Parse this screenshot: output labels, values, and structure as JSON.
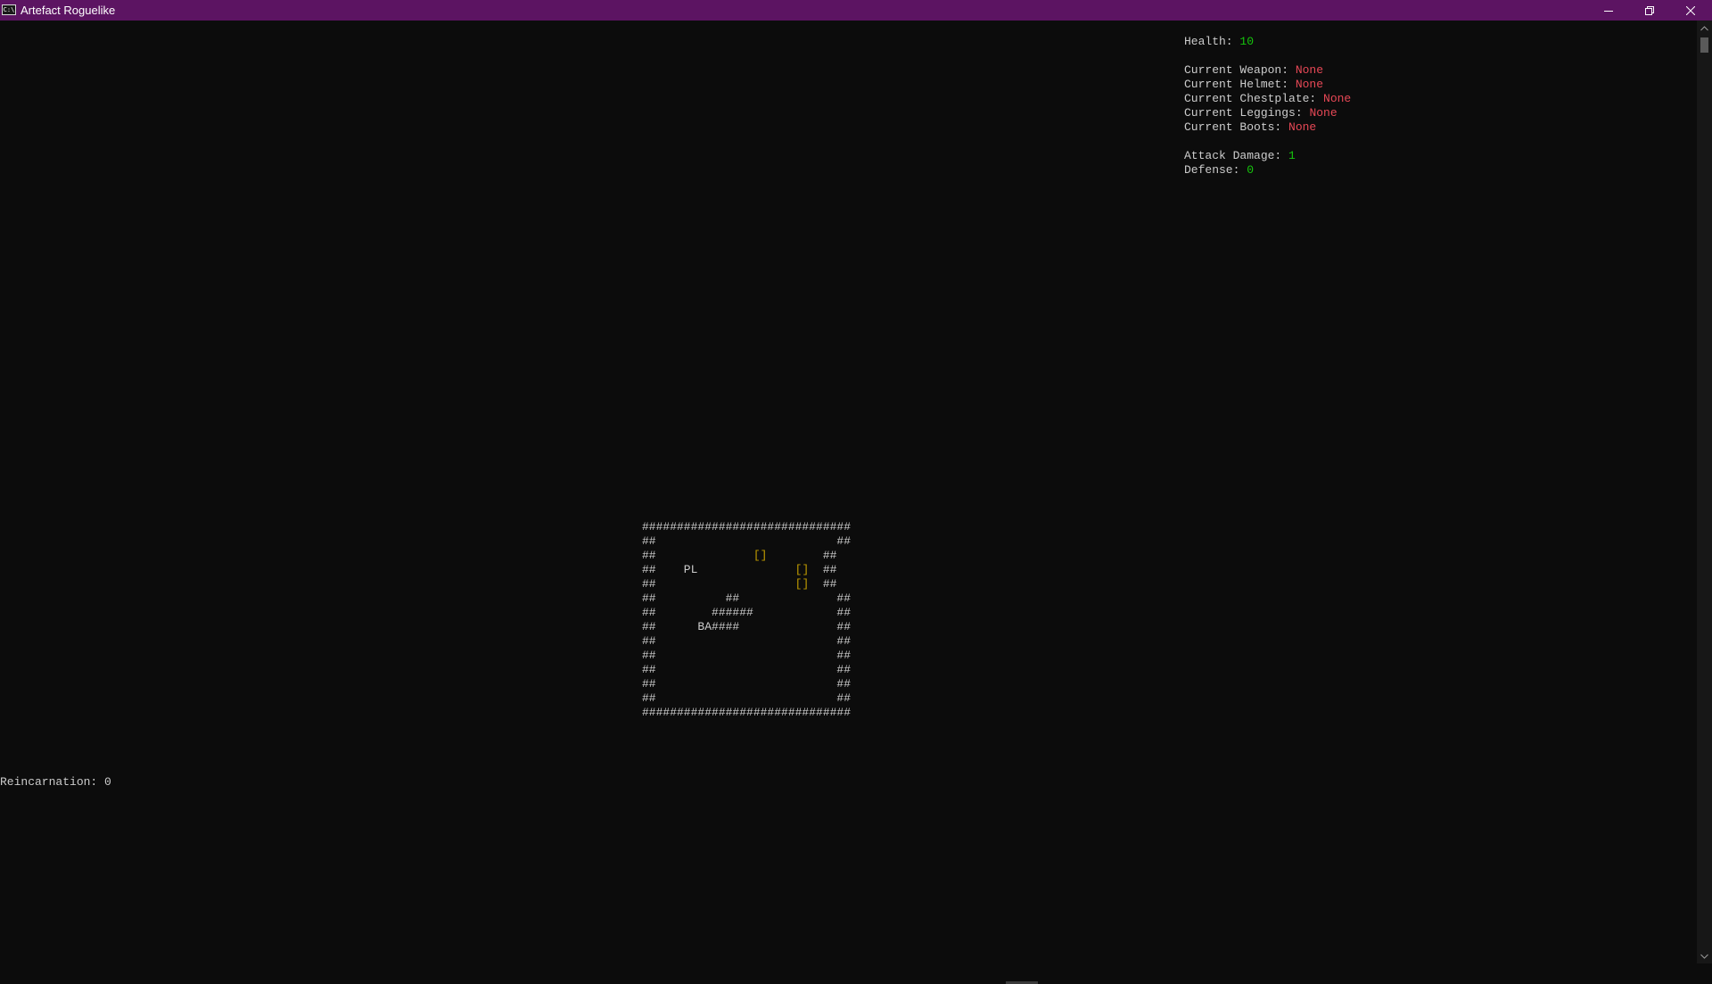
{
  "window": {
    "title": "Artefact Roguelike",
    "icon": "console-icon",
    "icon_text": "C:\\",
    "buttons": [
      "minimize-icon",
      "restore-icon",
      "close-icon"
    ]
  },
  "stats": {
    "health_label": "Health: ",
    "health_value": "10",
    "weapon_label": "Current Weapon: ",
    "weapon_value": "None",
    "helmet_label": "Current Helmet: ",
    "helmet_value": "None",
    "chestplate_label": "Current Chestplate: ",
    "chestplate_value": "None",
    "leggings_label": "Current Leggings: ",
    "leggings_value": "None",
    "boots_label": "Current Boots: ",
    "boots_value": "None",
    "attack_label": "Attack Damage: ",
    "attack_value": "1",
    "defense_label": "Defense: ",
    "defense_value": "0"
  },
  "map": {
    "rows": [
      [
        "##############################"
      ],
      [
        "##                          ##"
      ],
      [
        "##              ",
        {
          "t": "[]",
          "c": "item"
        },
        "        ##"
      ],
      [
        "##    PL              ",
        {
          "t": "[]",
          "c": "item"
        },
        "  ##"
      ],
      [
        "##                    ",
        {
          "t": "[]",
          "c": "item"
        },
        "  ##"
      ],
      [
        "##          ##              ##"
      ],
      [
        "##        ######            ##"
      ],
      [
        "##      BA####              ##"
      ],
      [
        "##                          ##"
      ],
      [
        "##                          ##"
      ],
      [
        "##                          ##"
      ],
      [
        "##                          ##"
      ],
      [
        "##                          ##"
      ],
      [
        "##############################"
      ]
    ]
  },
  "footer": {
    "reincarnation_label": "Reincarnation: ",
    "reincarnation_value": "0"
  },
  "colors": {
    "titlebar": "#5c1462",
    "background": "#0c0c0c",
    "text": "#cccccc",
    "good_value": "#16c60c",
    "bad_value": "#e74856",
    "item": "#c19c00"
  }
}
